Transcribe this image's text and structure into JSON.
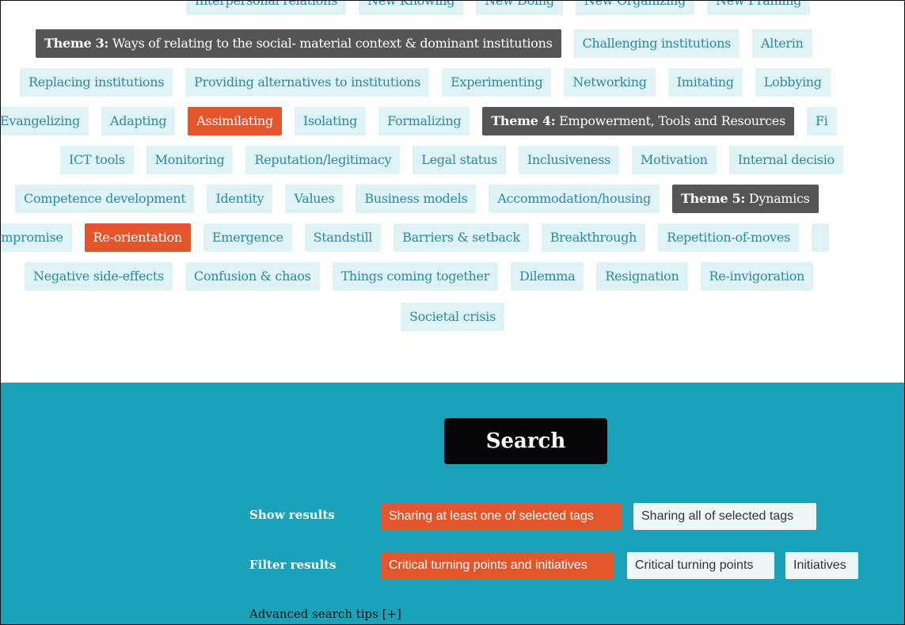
{
  "rows": [
    {
      "offset": 234,
      "tags": [
        {
          "label": "Interpersonal relations",
          "kind": "tag"
        },
        {
          "label": "New Knowing",
          "kind": "tag"
        },
        {
          "label": "New Doing",
          "kind": "tag"
        },
        {
          "label": "New Organizing",
          "kind": "tag"
        },
        {
          "label": "New Framing",
          "kind": "tag"
        }
      ]
    },
    {
      "offset": 44,
      "tags": [
        {
          "label": "Ways of relating to the social- material context & dominant institutions",
          "prefix": "Theme 3:",
          "kind": "theme"
        },
        {
          "label": "Challenging institutions",
          "kind": "tag"
        },
        {
          "label": "Alterin",
          "kind": "tag"
        }
      ]
    },
    {
      "offset": 24,
      "tags": [
        {
          "label": "Replacing institutions",
          "kind": "tag"
        },
        {
          "label": "Providing alternatives to institutions",
          "kind": "tag"
        },
        {
          "label": "Experimenting",
          "kind": "tag"
        },
        {
          "label": "Networking",
          "kind": "tag"
        },
        {
          "label": "Imitating",
          "kind": "tag"
        },
        {
          "label": "Lobbying",
          "kind": "tag"
        }
      ]
    },
    {
      "offset": -12,
      "tags": [
        {
          "label": "Evangelizing",
          "kind": "tag"
        },
        {
          "label": "Adapting",
          "kind": "tag"
        },
        {
          "label": "Assimilating",
          "kind": "sel"
        },
        {
          "label": "Isolating",
          "kind": "tag"
        },
        {
          "label": "Formalizing",
          "kind": "tag"
        },
        {
          "label": "Empowerment, Tools and Resources",
          "prefix": "Theme 4:",
          "kind": "theme"
        },
        {
          "label": "Fi",
          "kind": "tag"
        }
      ]
    },
    {
      "offset": 75,
      "tags": [
        {
          "label": "ICT tools",
          "kind": "tag"
        },
        {
          "label": "Monitoring",
          "kind": "tag"
        },
        {
          "label": "Reputation/legitimacy",
          "kind": "tag"
        },
        {
          "label": "Legal status",
          "kind": "tag"
        },
        {
          "label": "Inclusiveness",
          "kind": "tag"
        },
        {
          "label": "Motivation",
          "kind": "tag"
        },
        {
          "label": "Internal decisio",
          "kind": "tag"
        }
      ]
    },
    {
      "offset": 18,
      "tags": [
        {
          "label": "Competence development",
          "kind": "tag"
        },
        {
          "label": "Identity",
          "kind": "tag"
        },
        {
          "label": "Values",
          "kind": "tag"
        },
        {
          "label": "Business models",
          "kind": "tag"
        },
        {
          "label": "Accommodation/housing",
          "kind": "tag"
        },
        {
          "label": "Dynamics",
          "prefix": "Theme 5:",
          "kind": "theme"
        }
      ]
    },
    {
      "offset": -32,
      "tags": [
        {
          "label": "Compromise",
          "kind": "tag"
        },
        {
          "label": "Re-orientation",
          "kind": "sel"
        },
        {
          "label": "Emergence",
          "kind": "tag"
        },
        {
          "label": "Standstill",
          "kind": "tag"
        },
        {
          "label": "Barriers & setback",
          "kind": "tag"
        },
        {
          "label": "Breakthrough",
          "kind": "tag"
        },
        {
          "label": "Repetition-of-moves",
          "kind": "tag"
        },
        {
          "label": "",
          "kind": "tag"
        }
      ]
    },
    {
      "offset": 30,
      "tags": [
        {
          "label": "Negative side-effects",
          "kind": "tag"
        },
        {
          "label": "Confusion & chaos",
          "kind": "tag"
        },
        {
          "label": "Things coming together",
          "kind": "tag"
        },
        {
          "label": "Dilemma",
          "kind": "tag"
        },
        {
          "label": "Resignation",
          "kind": "tag"
        },
        {
          "label": "Re-invigoration",
          "kind": "tag"
        }
      ]
    },
    {
      "offset": null,
      "tags": [
        {
          "label": "Societal crisis",
          "kind": "tag"
        }
      ]
    }
  ],
  "search": {
    "button_label": "Search",
    "show_results_label": "Show results",
    "show_options": [
      "Sharing at least one of selected tags",
      "Sharing all of selected tags"
    ],
    "show_active": 0,
    "filter_results_label": "Filter results",
    "filter_options": [
      "Critical turning points and initiatives",
      "Critical turning points",
      "Initiatives"
    ],
    "filter_active": 0,
    "tips_label": "Advanced search tips [+]"
  },
  "colors": {
    "tag_bg": "#dff2f6",
    "tag_text": "#2a8ba3",
    "selected": "#e4552b",
    "theme": "#555555",
    "search_bg": "#1aa3b8"
  }
}
